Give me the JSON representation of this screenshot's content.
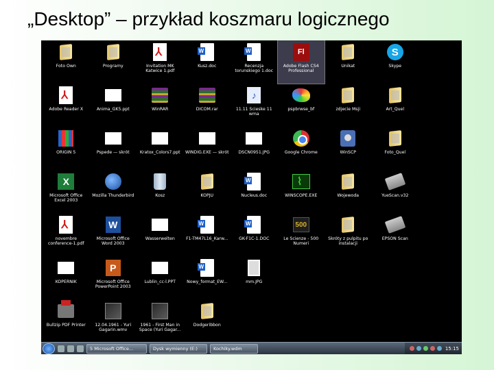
{
  "slide": {
    "title": "„Desktop” – przykład koszmaru logicznego"
  },
  "desktop": {
    "icons": [
      {
        "label": "Foto Own",
        "icon": "folder"
      },
      {
        "label": "Programy",
        "icon": "folder"
      },
      {
        "label": "Invitation MK Katwice 1.pdf",
        "icon": "pdf"
      },
      {
        "label": "Kusz.doc",
        "icon": "doc"
      },
      {
        "label": "Recenzja torunskiego 1.doc",
        "icon": "doc"
      },
      {
        "label": "Adobe Flash CS4 Professional",
        "icon": "flash",
        "selected": true
      },
      {
        "label": "Unikat",
        "icon": "folder"
      },
      {
        "label": "Skype",
        "icon": "skype"
      },
      {
        "label": "Adobe Reader X",
        "icon": "pdf"
      },
      {
        "label": "Anima_GK5.ppt",
        "icon": "white"
      },
      {
        "label": "WinRAR",
        "icon": "rar"
      },
      {
        "label": "DICOM.rar",
        "icon": "rar"
      },
      {
        "label": "11.11 Scieske 11 wma",
        "icon": "music"
      },
      {
        "label": "pspbrwse_bf",
        "icon": "paint"
      },
      {
        "label": "zdjecie Msji",
        "icon": "folder"
      },
      {
        "label": "Art_Quel",
        "icon": "folder"
      },
      {
        "label": "ORIGIN 5",
        "icon": "grid-icon"
      },
      {
        "label": "Pspede — skrót",
        "icon": "white"
      },
      {
        "label": "Kratox_Colors7.ppt",
        "icon": "white"
      },
      {
        "label": "WINDIG.EXE — skrót",
        "icon": "white"
      },
      {
        "label": "DSCN0951.JPG",
        "icon": "white"
      },
      {
        "label": "Google Chrome",
        "icon": "chrome"
      },
      {
        "label": "WinSCP",
        "icon": "winscp"
      },
      {
        "label": "Foto_Quel",
        "icon": "folder"
      },
      {
        "label": "Microsoft Office Excel 2003",
        "icon": "excel"
      },
      {
        "label": "Mozilla Thunderbird",
        "icon": "bird"
      },
      {
        "label": "Kosz",
        "icon": "trash"
      },
      {
        "label": "KOPJU",
        "icon": "folder"
      },
      {
        "label": "Nucleus.doc",
        "icon": "doc"
      },
      {
        "label": "WINSCOPE.EXE",
        "icon": "scope"
      },
      {
        "label": "Wojewoda",
        "icon": "folder"
      },
      {
        "label": "YueScan.v32",
        "icon": "scan"
      },
      {
        "label": "novembre conference-1.pdf",
        "icon": "pdf"
      },
      {
        "label": "Microsoft Office Word 2003",
        "icon": "word"
      },
      {
        "label": "Wasserwelten",
        "icon": "white"
      },
      {
        "label": "F1-TM47L16_Karw...",
        "icon": "doc"
      },
      {
        "label": "GK-F1C-1.DOC",
        "icon": "doc"
      },
      {
        "label": "Le Scienze - 500 Numeri",
        "icon": "sci"
      },
      {
        "label": "Skróty z pulpitu po instalacji",
        "icon": "folder"
      },
      {
        "label": "EPSON Scan",
        "icon": "scan"
      },
      {
        "label": "KOPERNIK",
        "icon": "white"
      },
      {
        "label": "Microsoft Office PowerPoint 2003",
        "icon": "office-ppt"
      },
      {
        "label": "Lublin_cc-l.PPT",
        "icon": "white"
      },
      {
        "label": "Nowy_format_EW...",
        "icon": "doc"
      },
      {
        "label": "mm.JPG",
        "icon": "jpg"
      },
      {
        "label": "",
        "icon": "none"
      },
      {
        "label": "",
        "icon": "none"
      },
      {
        "label": "",
        "icon": "none"
      },
      {
        "label": "Bullzip PDF Printer",
        "icon": "pdfprinter"
      },
      {
        "label": "12.04.1961 - Yuri Gagarin.wmv",
        "icon": "game"
      },
      {
        "label": "1961 - First Man in Space (Yuri Gagar...",
        "icon": "game"
      },
      {
        "label": "Dodgeribbon",
        "icon": "folder"
      }
    ]
  },
  "taskbar": {
    "buttons": [
      "5 Microsoft Office...",
      "Dysk wymienny (E:)",
      "Kochiky.wdm"
    ],
    "clock": "15:15"
  }
}
